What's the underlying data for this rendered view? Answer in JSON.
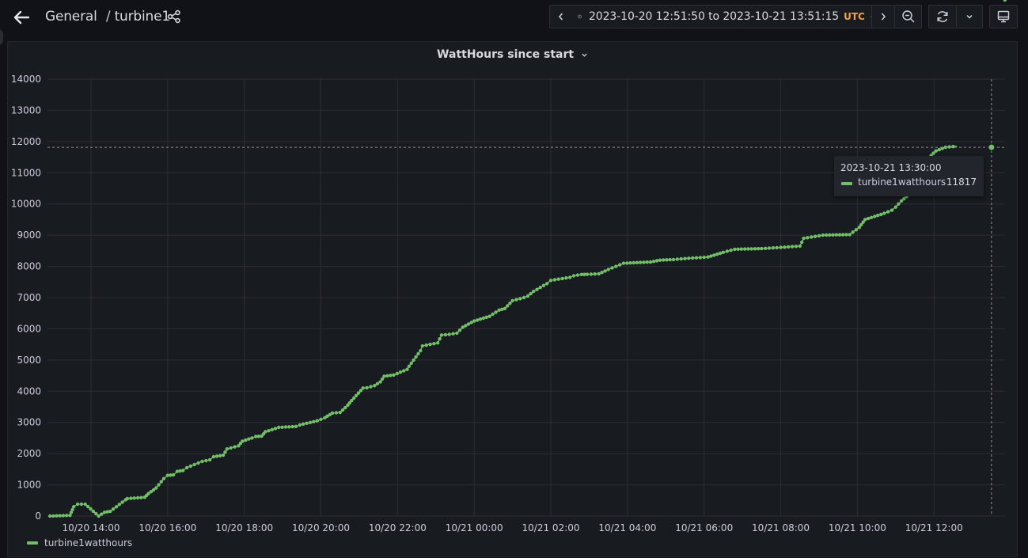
{
  "header": {
    "breadcrumb_folder": "General",
    "breadcrumb_separator": "/",
    "breadcrumb_dashboard": "turbine1",
    "icons": {
      "back": "arrow-left-icon",
      "share": "share-icon",
      "prev": "chevron-left-icon",
      "clock": "clock-icon",
      "time_dropdown": "chevron-down-icon",
      "next": "chevron-right-icon",
      "zoom_out": "zoom-out-icon",
      "refresh": "refresh-icon",
      "refresh_dropdown": "chevron-down-icon",
      "tv_mode": "monitor-icon"
    }
  },
  "time_range": {
    "text": "2023-10-20 12:51:50 to 2023-10-21 13:51:15",
    "timezone": "UTC"
  },
  "panel": {
    "title": "WattHours since start"
  },
  "tooltip": {
    "time": "2023-10-21 13:30:00",
    "series": "turbine1watthours",
    "value": "11817"
  },
  "legend": {
    "series_name": "turbine1watthours"
  },
  "colors": {
    "series": "#73bf69",
    "timezone": "#f5a142",
    "background": "#111217",
    "panel": "#181b1f",
    "grid": "#2c2e34"
  },
  "chart_data": {
    "type": "line",
    "title": "WattHours since start",
    "xlabel": "",
    "ylabel": "",
    "x_start": "2023-10-20 12:51:50",
    "x_end": "2023-10-21 13:51:15",
    "xlim_hours": [
      12.864,
      37.854
    ],
    "ylim": [
      0,
      14000
    ],
    "yticks": [
      "0",
      "1000",
      "2000",
      "3000",
      "4000",
      "5000",
      "6000",
      "7000",
      "8000",
      "9000",
      "10000",
      "11000",
      "12000",
      "13000",
      "14000"
    ],
    "xticks": [
      {
        "h": 14,
        "label": "10/20 14:00"
      },
      {
        "h": 16,
        "label": "10/20 16:00"
      },
      {
        "h": 18,
        "label": "10/20 18:00"
      },
      {
        "h": 20,
        "label": "10/20 20:00"
      },
      {
        "h": 22,
        "label": "10/20 22:00"
      },
      {
        "h": 24,
        "label": "10/21 00:00"
      },
      {
        "h": 26,
        "label": "10/21 02:00"
      },
      {
        "h": 28,
        "label": "10/21 04:00"
      },
      {
        "h": 30,
        "label": "10/21 06:00"
      },
      {
        "h": 32,
        "label": "10/21 08:00"
      },
      {
        "h": 34,
        "label": "10/21 10:00"
      },
      {
        "h": 36,
        "label": "10/21 12:00"
      }
    ],
    "grid": true,
    "legend": "bottom-left",
    "hover_time_hours": 37.5,
    "series": [
      {
        "name": "turbine1watthours",
        "color": "#73bf69",
        "x_hours": [
          12.93,
          13.45,
          13.55,
          13.65,
          13.85,
          14.2,
          14.35,
          14.5,
          14.9,
          14.95,
          15.4,
          15.5,
          15.7,
          15.9,
          16.0,
          16.15,
          16.25,
          16.4,
          16.5,
          16.6,
          16.9,
          17.1,
          17.2,
          17.45,
          17.55,
          17.85,
          17.95,
          18.2,
          18.3,
          18.45,
          18.55,
          18.9,
          19.35,
          19.45,
          19.9,
          20.1,
          20.3,
          20.5,
          20.7,
          20.8,
          21.1,
          21.2,
          21.4,
          21.55,
          21.65,
          21.9,
          22.25,
          22.3,
          22.6,
          22.65,
          22.85,
          23.05,
          23.15,
          23.35,
          23.55,
          23.7,
          24.0,
          24.4,
          24.65,
          24.8,
          25.0,
          25.3,
          25.4,
          25.55,
          25.9,
          26.0,
          26.5,
          26.6,
          26.8,
          26.95,
          27.25,
          27.5,
          27.7,
          27.9,
          28.6,
          28.85,
          29.2,
          29.5,
          29.6,
          30.1,
          30.5,
          30.8,
          31.5,
          31.9,
          32.5,
          32.6,
          33.1,
          33.8,
          34.05,
          34.2,
          34.7,
          34.9,
          35.0,
          35.15,
          35.35,
          35.5,
          35.8,
          36.05,
          36.3,
          36.6,
          37.35,
          37.45,
          37.5,
          37.85
        ],
        "values": [
          0,
          20,
          300,
          380,
          380,
          0,
          120,
          150,
          520,
          560,
          600,
          720,
          900,
          1200,
          1300,
          1320,
          1430,
          1460,
          1550,
          1600,
          1750,
          1800,
          1900,
          1950,
          2150,
          2250,
          2400,
          2500,
          2550,
          2560,
          2700,
          2840,
          2870,
          2920,
          3050,
          3150,
          3300,
          3320,
          3550,
          3700,
          4100,
          4110,
          4180,
          4300,
          4480,
          4520,
          4700,
          4800,
          5300,
          5450,
          5500,
          5550,
          5800,
          5820,
          5860,
          6050,
          6250,
          6400,
          6600,
          6650,
          6900,
          7000,
          7050,
          7200,
          7450,
          7550,
          7650,
          7700,
          7740,
          7745,
          7760,
          7900,
          8000,
          8100,
          8140,
          8200,
          8220,
          8250,
          8260,
          8300,
          8450,
          8550,
          8570,
          8600,
          8650,
          8900,
          9000,
          9020,
          9250,
          9500,
          9700,
          9800,
          9900,
          10100,
          10300,
          10700,
          11400,
          11700,
          11817,
          11850
        ]
      }
    ]
  }
}
